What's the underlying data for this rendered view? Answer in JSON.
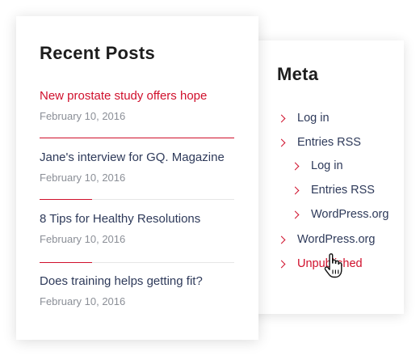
{
  "recent_posts": {
    "heading": "Recent Posts",
    "posts": [
      {
        "title": "New prostate study offers hope",
        "date": "February 10, 2016"
      },
      {
        "title": "Jane's interview for GQ. Magazine",
        "date": "February 10, 2016"
      },
      {
        "title": "8 Tips for Healthy Resolutions",
        "date": "February 10, 2016"
      },
      {
        "title": "Does training helps getting fit?",
        "date": "February 10, 2016"
      }
    ]
  },
  "meta": {
    "heading": "Meta",
    "items": [
      {
        "label": "Log in"
      },
      {
        "label": "Entries RSS"
      },
      {
        "label": "Log in"
      },
      {
        "label": "Entries RSS"
      },
      {
        "label": "WordPress.org"
      },
      {
        "label": "WordPress.org"
      },
      {
        "label": "Unpublished"
      }
    ]
  },
  "colors": {
    "accent": "#d0102c",
    "text": "#2e3a5a",
    "muted": "#8b8f97",
    "heading": "#1d1d1d"
  },
  "cursor": "hand-pointer-icon"
}
